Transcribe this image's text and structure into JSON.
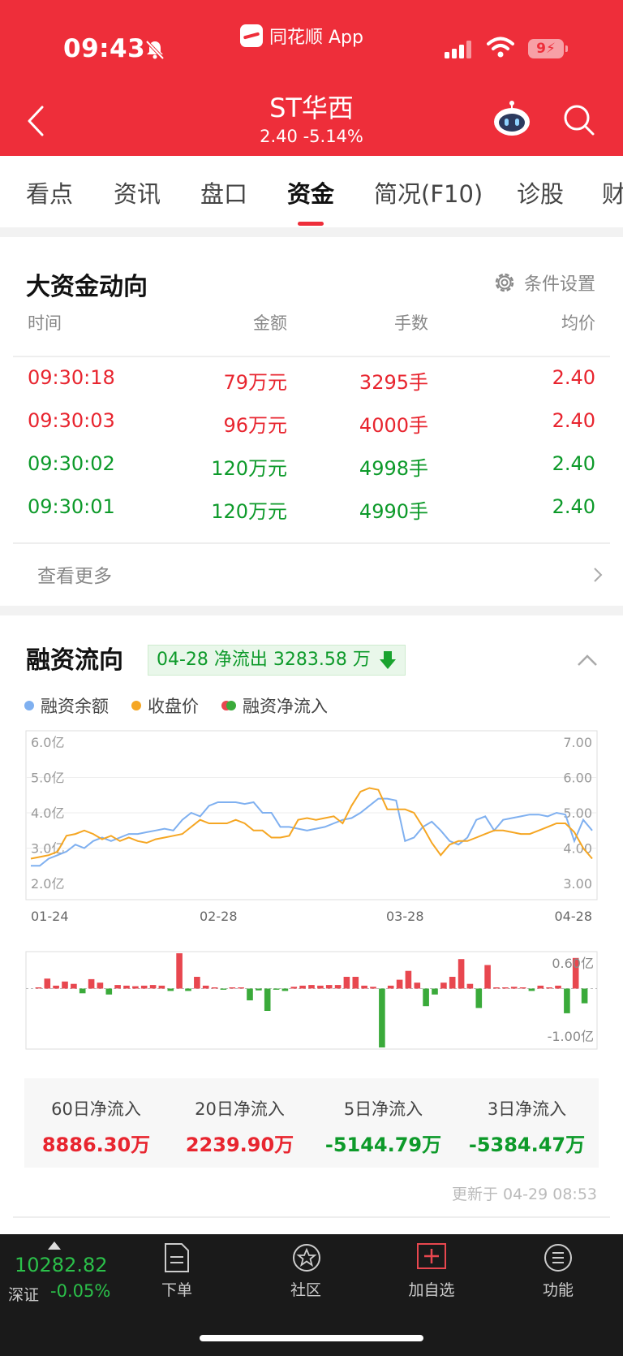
{
  "status_bar": {
    "time": "09:43",
    "source_app": "同花顺 App",
    "battery": "9"
  },
  "header": {
    "title": "ST华西",
    "price": "2.40",
    "change": "-5.14%"
  },
  "tabs": [
    {
      "label": "看点"
    },
    {
      "label": "资讯"
    },
    {
      "label": "盘口"
    },
    {
      "label": "资金",
      "active": true
    },
    {
      "label": "简况(F10)"
    },
    {
      "label": "诊股"
    },
    {
      "label": "财"
    }
  ],
  "big_capital": {
    "title": "大资金动向",
    "settings_label": "条件设置",
    "headers": [
      "时间",
      "金额",
      "手数",
      "均价"
    ],
    "rows": [
      {
        "time": "09:30:18",
        "amount": "79万元",
        "volume": "3295手",
        "price": "2.40",
        "color": "red"
      },
      {
        "time": "09:30:03",
        "amount": "96万元",
        "volume": "4000手",
        "price": "2.40",
        "color": "red"
      },
      {
        "time": "09:30:02",
        "amount": "120万元",
        "volume": "4998手",
        "price": "2.40",
        "color": "green"
      },
      {
        "time": "09:30:01",
        "amount": "120万元",
        "volume": "4990手",
        "price": "2.40",
        "color": "green"
      }
    ],
    "more_label": "查看更多"
  },
  "margin_flow": {
    "title": "融资流向",
    "badge": "04-28 净流出 3283.58 万",
    "legend": {
      "balance": "融资余额",
      "close": "收盘价",
      "net": "融资净流入"
    },
    "colors": {
      "balance": "#7fb0f0",
      "close": "#f5a623",
      "up": "#e8474f",
      "down": "#3aaa3a"
    },
    "summary": [
      {
        "label": "60日净流入",
        "value": "8886.30万",
        "color": "red"
      },
      {
        "label": "20日净流入",
        "value": "2239.90万",
        "color": "red"
      },
      {
        "label": "5日净流入",
        "value": "-5144.79万",
        "color": "green"
      },
      {
        "label": "3日净流入",
        "value": "-5384.47万",
        "color": "green"
      }
    ],
    "update_time": "更新于 04-29 08:53"
  },
  "chart_data": [
    {
      "type": "line",
      "x_ticks": [
        "01-24",
        "02-28",
        "03-28",
        "04-28"
      ],
      "left_ticks": [
        "6.0亿",
        "5.0亿",
        "4.0亿",
        "3.0亿",
        "2.0亿"
      ],
      "right_ticks": [
        "7.00",
        "6.00",
        "5.00",
        "4.00",
        "3.00"
      ],
      "ylim_left": [
        2.0,
        6.0
      ],
      "ylim_right": [
        3.0,
        7.0
      ],
      "series": [
        {
          "name": "融资余额",
          "color": "#7fb0f0",
          "axis": "left",
          "values": [
            2.5,
            2.5,
            2.7,
            2.8,
            2.9,
            3.1,
            3.0,
            3.2,
            3.3,
            3.2,
            3.3,
            3.4,
            3.4,
            3.45,
            3.5,
            3.55,
            3.5,
            3.8,
            4.0,
            3.9,
            4.2,
            4.3,
            4.3,
            4.3,
            4.25,
            4.3,
            4.0,
            4.0,
            3.6,
            3.6,
            3.55,
            3.5,
            3.55,
            3.6,
            3.7,
            3.8,
            3.85,
            4.0,
            4.2,
            4.4,
            4.4,
            4.35,
            3.2,
            3.3,
            3.6,
            3.75,
            3.5,
            3.2,
            3.1,
            3.3,
            3.8,
            3.9,
            3.5,
            3.8,
            3.85,
            3.9,
            3.95,
            3.95,
            3.9,
            4.0,
            3.95,
            3.2,
            3.8,
            3.5
          ]
        },
        {
          "name": "收盘价",
          "color": "#f5a623",
          "axis": "right",
          "values": [
            3.7,
            3.75,
            3.8,
            3.9,
            4.35,
            4.4,
            4.5,
            4.4,
            4.25,
            4.35,
            4.2,
            4.3,
            4.2,
            4.15,
            4.25,
            4.3,
            4.35,
            4.4,
            4.6,
            4.8,
            4.7,
            4.7,
            4.7,
            4.8,
            4.7,
            4.5,
            4.5,
            4.3,
            4.3,
            4.35,
            4.8,
            4.85,
            4.8,
            4.85,
            4.9,
            4.7,
            5.2,
            5.6,
            5.7,
            5.65,
            5.1,
            5.1,
            5.1,
            5.0,
            4.6,
            4.15,
            3.8,
            4.1,
            4.2,
            4.2,
            4.3,
            4.4,
            4.5,
            4.5,
            4.45,
            4.4,
            4.4,
            4.5,
            4.6,
            4.7,
            4.7,
            4.45,
            4.0,
            3.7
          ]
        }
      ]
    },
    {
      "type": "bar",
      "name": "融资净流入",
      "ylim": [
        -1.0,
        0.6
      ],
      "ticks": [
        "0.60亿",
        "-1.00亿"
      ],
      "values": [
        0.02,
        0.17,
        0.05,
        0.12,
        0.08,
        -0.08,
        0.16,
        0.1,
        -0.1,
        0.06,
        0.05,
        0.04,
        0.05,
        0.06,
        0.05,
        -0.04,
        0.6,
        -0.04,
        0.2,
        0.05,
        0.02,
        -0.02,
        0.02,
        0.02,
        -0.2,
        -0.03,
        -0.38,
        -0.02,
        -0.04,
        0.03,
        0.05,
        0.06,
        0.05,
        0.06,
        0.06,
        0.2,
        0.2,
        0.05,
        0.03,
        -1.0,
        0.05,
        0.15,
        0.3,
        0.1,
        -0.3,
        -0.1,
        0.1,
        0.2,
        0.5,
        0.08,
        -0.33,
        0.4,
        0.02,
        0.02,
        0.03,
        0.02,
        -0.04,
        0.05,
        0.02,
        0.05,
        -0.42,
        0.52,
        -0.25
      ]
    }
  ],
  "bottom_bar": {
    "index_value": "10282.82",
    "index_name": "深证",
    "index_change": "-0.05%",
    "nav": [
      {
        "label": "下单"
      },
      {
        "label": "社区"
      },
      {
        "label": "加自选"
      },
      {
        "label": "功能"
      }
    ]
  }
}
